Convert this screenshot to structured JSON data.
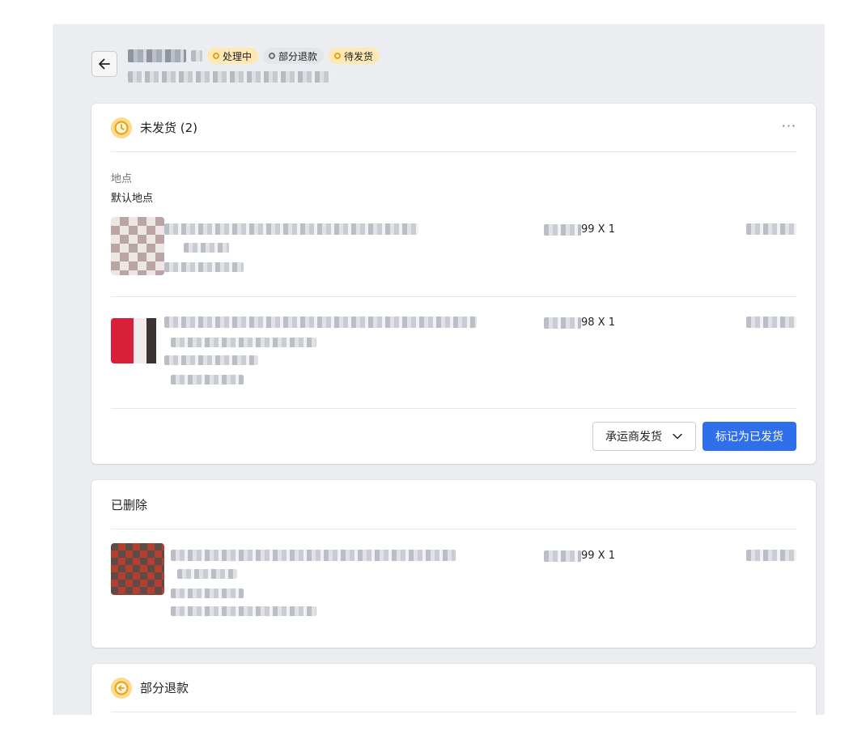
{
  "header": {
    "back_icon": "arrow-left-icon",
    "badges": [
      {
        "label": "处理中",
        "tone": "warning"
      },
      {
        "label": "部分退款",
        "tone": "neutral"
      },
      {
        "label": "待发货",
        "tone": "warning"
      }
    ]
  },
  "unfulfilled": {
    "title": "未发货 (2)",
    "icon": "clock-icon",
    "more_label": "···",
    "location_label": "地点",
    "location_value": "默认地点",
    "items": [
      {
        "qty_suffix": "99 X 1"
      },
      {
        "qty_suffix": "98 X 1"
      }
    ],
    "carrier_button": "承运商发货",
    "mark_shipped_button": "标记为已发货"
  },
  "removed": {
    "title": "已删除",
    "items": [
      {
        "qty_suffix": "99 X 1"
      }
    ]
  },
  "refund": {
    "title": "部分退款",
    "icon": "refund-arrow-icon"
  },
  "colors": {
    "primary": "#2f6feb",
    "warning_badge": "#ffe8b4",
    "neutral_badge": "#e4e5e7",
    "canvas": "#ecedf0"
  }
}
